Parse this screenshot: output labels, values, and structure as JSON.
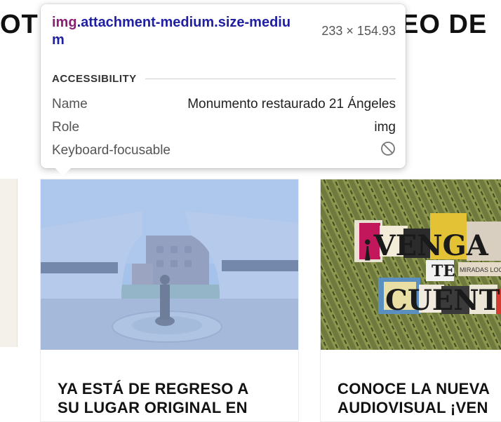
{
  "page": {
    "heading_left": "OT",
    "heading_right": "EO DE"
  },
  "tooltip": {
    "selector_tag": "img",
    "selector_classes": ".attachment-medium.size-medium",
    "dimensions": "233 × 154.93",
    "section_label": "ACCESSIBILITY",
    "rows": [
      {
        "key": "Name",
        "value": "Monumento restaurado 21 Ángeles"
      },
      {
        "key": "Role",
        "value": "img"
      },
      {
        "key": "Keyboard-focusable",
        "value_icon": "not-allowed-icon"
      }
    ]
  },
  "cards": [
    {
      "title": "YA ESTÁ DE REGRESO A\nSU LUGAR ORIGINAL EN"
    },
    {
      "title": "CONOCE LA NUEVA\nAUDIOVISUAL ¡VEN"
    }
  ],
  "poster": {
    "line1": "¡VENGA",
    "line2": "TE",
    "line3": "CUENTO",
    "tag": "MIRADAS LOCA"
  },
  "colors": {
    "selector_tag": "#8a1f74",
    "selector_class": "#1f1fa3",
    "highlight_overlay": "#9fc1f0"
  }
}
